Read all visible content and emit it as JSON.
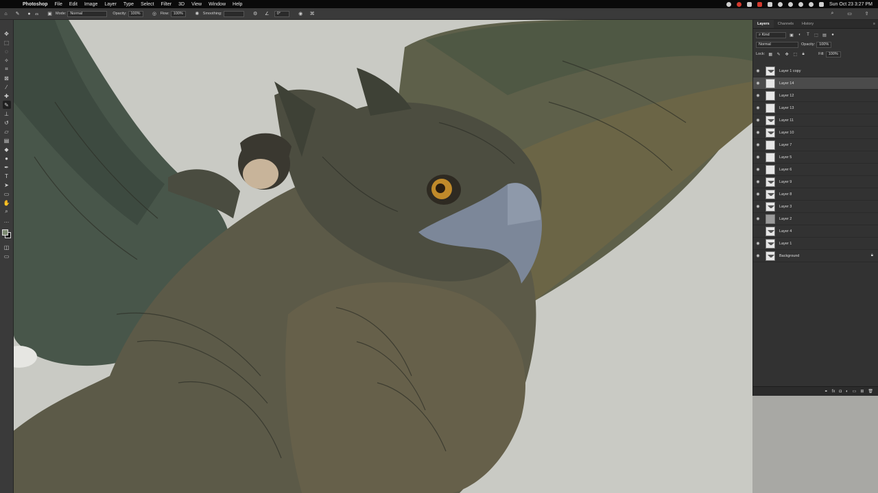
{
  "menubar": {
    "apple_icon": "apple-icon",
    "items": [
      "Photoshop",
      "File",
      "Edit",
      "Image",
      "Layer",
      "Type",
      "Select",
      "Filter",
      "3D",
      "View",
      "Window",
      "Help"
    ],
    "datetime": "Sun Oct 23  3:27 PM"
  },
  "options": {
    "brush_size": "45",
    "mode_label": "Mode:",
    "mode_value": "Normal",
    "opacity_label": "Opacity:",
    "opacity_value": "100%",
    "flow_label": "Flow:",
    "flow_value": "100%",
    "smoothing_label": "Smoothing:",
    "angle_value": "0°"
  },
  "colors": {
    "foreground": "#7d8a72",
    "background": "#111111",
    "canvas_bg": "#c9cac4",
    "panel_bg": "#323232"
  },
  "panel": {
    "tabs": [
      "Layers",
      "Channels",
      "History"
    ],
    "filter_label": "Kind",
    "blend_mode": "Normal",
    "opacity_label": "Opacity:",
    "opacity_value": "100%",
    "lock_label": "Lock:",
    "fill_label": "Fill:",
    "fill_value": "100%",
    "layers": [
      {
        "name": "Layer 1 copy",
        "thumb": "bird",
        "visible": true
      },
      {
        "name": "Layer 14",
        "thumb": "blank",
        "visible": true,
        "selected": true
      },
      {
        "name": "Layer 12",
        "thumb": "blank",
        "visible": true
      },
      {
        "name": "Layer 13",
        "thumb": "blank",
        "visible": true
      },
      {
        "name": "Layer 11",
        "thumb": "bird",
        "visible": true
      },
      {
        "name": "Layer 10",
        "thumb": "bird",
        "visible": true
      },
      {
        "name": "Layer 7",
        "thumb": "blank",
        "visible": true
      },
      {
        "name": "Layer 5",
        "thumb": "blank",
        "visible": true
      },
      {
        "name": "Layer 6",
        "thumb": "blank",
        "visible": true
      },
      {
        "name": "Layer 9",
        "thumb": "bird",
        "visible": true
      },
      {
        "name": "Layer 8",
        "thumb": "bird",
        "visible": true
      },
      {
        "name": "Layer 3",
        "thumb": "bird",
        "visible": true
      },
      {
        "name": "Layer 2",
        "thumb": "mid",
        "visible": true
      },
      {
        "name": "Layer 4",
        "thumb": "bird",
        "visible": false
      },
      {
        "name": "Layer 1",
        "thumb": "bird",
        "visible": true
      },
      {
        "name": "Background",
        "thumb": "bird",
        "visible": true,
        "locked": true
      }
    ]
  }
}
